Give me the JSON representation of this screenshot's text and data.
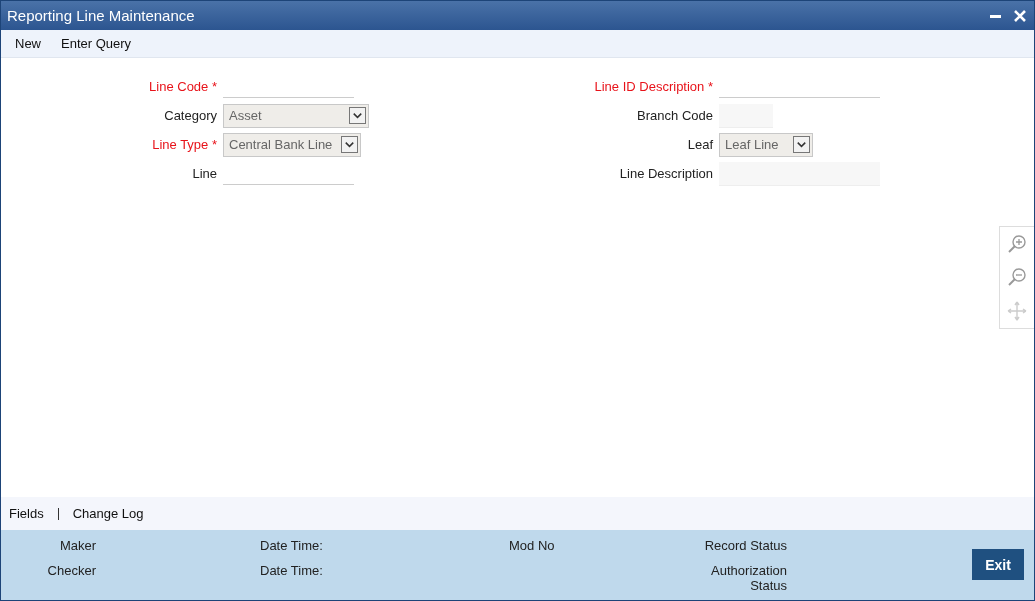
{
  "window": {
    "title": "Reporting Line Maintenance"
  },
  "toolbar": [
    "New",
    "Enter Query"
  ],
  "form": {
    "left": [
      {
        "label": "Line Code *",
        "required": true,
        "kind": "text"
      },
      {
        "label": "Category",
        "required": false,
        "kind": "select",
        "value": "Asset"
      },
      {
        "label": "Line Type *",
        "required": true,
        "kind": "select",
        "value": "Central Bank Line"
      },
      {
        "label": "Line",
        "required": false,
        "kind": "text"
      }
    ],
    "right": [
      {
        "label": "Line ID Description *",
        "required": true,
        "kind": "text"
      },
      {
        "label": "Branch Code",
        "required": false,
        "kind": "readonly"
      },
      {
        "label": "Leaf",
        "required": false,
        "kind": "select",
        "value": "Leaf Line"
      },
      {
        "label": "Line Description",
        "required": false,
        "kind": "readonly"
      }
    ]
  },
  "footer_links": [
    "Fields",
    "Change Log"
  ],
  "audit": {
    "maker": "Maker",
    "checker": "Checker",
    "date_time_1": "Date Time:",
    "date_time_2": "Date Time:",
    "mod_no": "Mod No",
    "record_status": "Record Status",
    "authorization_status": "Authorization Status"
  },
  "buttons": [
    "Exit"
  ]
}
